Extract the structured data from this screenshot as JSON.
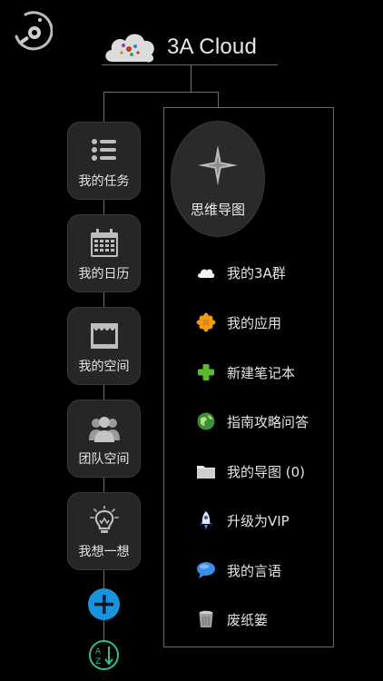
{
  "header": {
    "title": "3A Cloud"
  },
  "left_nav": [
    {
      "label": "我的任务",
      "icon": "task-list-icon"
    },
    {
      "label": "我的日历",
      "icon": "calendar-icon"
    },
    {
      "label": "我的空间",
      "icon": "shop-space-icon"
    },
    {
      "label": "团队空间",
      "icon": "team-icon"
    },
    {
      "label": "我想一想",
      "icon": "lightbulb-icon"
    }
  ],
  "mindmap": {
    "label": "思维导图",
    "icon": "compass-star-icon"
  },
  "menu": [
    {
      "label": "我的3A群",
      "icon": "cloud-icon"
    },
    {
      "label": "我的应用",
      "icon": "flower-icon"
    },
    {
      "label": "新建笔记本",
      "icon": "green-plus-icon"
    },
    {
      "label": "指南攻略问答",
      "icon": "globe-icon"
    },
    {
      "label": "我的导图 (0)",
      "icon": "folder-icon"
    },
    {
      "label": "升级为VIP",
      "icon": "rocket-icon"
    },
    {
      "label": "我的言语",
      "icon": "speech-bubble-icon"
    },
    {
      "label": "废纸篓",
      "icon": "trash-icon"
    }
  ],
  "colors": {
    "background": "#000000",
    "tile": "#262626",
    "accent_blue": "#1793e0",
    "line": "#6e6e6e"
  }
}
